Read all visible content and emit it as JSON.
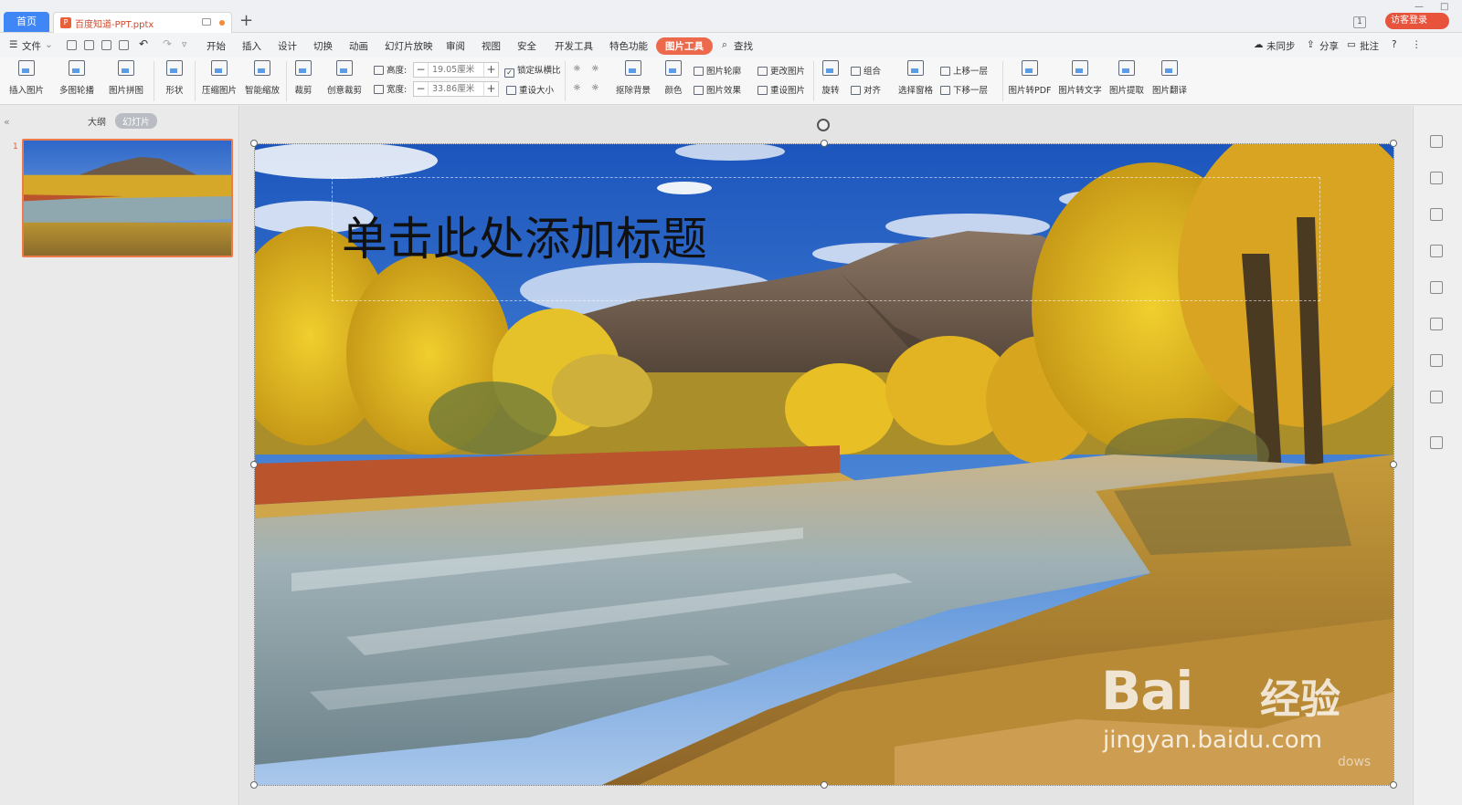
{
  "tabs": {
    "home": "首页",
    "document": "百度知道-PPT.pptx",
    "new_tab": "+",
    "page_count_badge": "1",
    "visitor_login": "访客登录"
  },
  "menu": {
    "file": "文件",
    "items": [
      "开始",
      "插入",
      "设计",
      "切换",
      "动画",
      "幻灯片放映",
      "审阅",
      "视图",
      "安全",
      "开发工具",
      "特色功能",
      "图片工具"
    ],
    "active": "图片工具",
    "search": "查找",
    "right": {
      "sync": "未同步",
      "share": "分享",
      "comment": "批注",
      "help": "?"
    }
  },
  "ribbon": {
    "insert_picture": "插入图片",
    "multi_carousel": "多图轮播",
    "picture_collage": "图片拼图",
    "shape": "形状",
    "compress_picture": "压缩图片",
    "smart_zoom": "智能缩放",
    "crop": "裁剪",
    "creative_crop": "创意裁剪",
    "height_label": "高度:",
    "height_value": "19.05厘米",
    "width_label": "宽度:",
    "width_value": "33.86厘米",
    "lock_ratio": "锁定纵横比",
    "reset_size": "重设大小",
    "remove_background": "抠除背景",
    "color": "颜色",
    "picture_outline": "图片轮廓",
    "picture_effect": "图片效果",
    "change_picture": "更改图片",
    "reset_picture": "重设图片",
    "rotate": "旋转",
    "group": "组合",
    "align": "对齐",
    "selection_pane": "选择窗格",
    "bring_forward": "上移一层",
    "send_backward": "下移一层",
    "to_pdf": "图片转PDF",
    "to_text": "图片转文字",
    "extract": "图片提取",
    "translate": "图片翻译"
  },
  "left_panel": {
    "outline_tab": "大纲",
    "slides_tab": "幻灯片",
    "slide_number": "1"
  },
  "slide": {
    "title_placeholder": "单击此处添加标题",
    "watermark_brand": "Bai",
    "watermark_brand_cn": "经验",
    "watermark_url": "jingyan.baidu.com",
    "os_watermark": "dows"
  },
  "colors": {
    "accent": "#ec6a4b",
    "home_tab": "#3f86f6",
    "visitor_button": "#e8533c",
    "thumbnail_border": "#ec7a4a"
  }
}
